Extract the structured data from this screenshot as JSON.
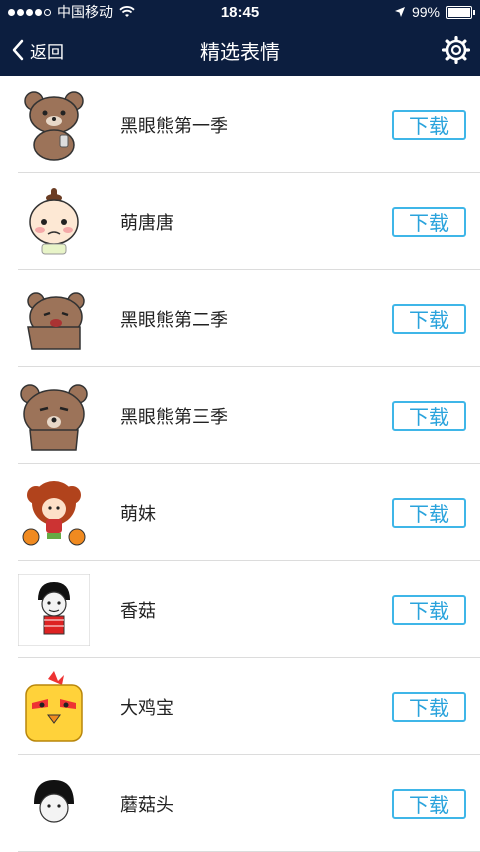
{
  "status": {
    "carrier": "中国移动",
    "time": "18:45",
    "battery": "99%"
  },
  "nav": {
    "back_label": "返回",
    "title": "精选表情"
  },
  "items": [
    {
      "name": "黑眼熊第一季",
      "download_label": "下载"
    },
    {
      "name": "萌唐唐",
      "download_label": "下载"
    },
    {
      "name": "黑眼熊第二季",
      "download_label": "下载"
    },
    {
      "name": "黑眼熊第三季",
      "download_label": "下载"
    },
    {
      "name": "萌妹",
      "download_label": "下载"
    },
    {
      "name": "香菇",
      "download_label": "下载"
    },
    {
      "name": "大鸡宝",
      "download_label": "下载"
    },
    {
      "name": "蘑菇头",
      "download_label": "下载"
    }
  ],
  "colors": {
    "nav_bg": "#0c1e3f",
    "accent": "#3fb6e8",
    "divider": "#dcdcdc"
  },
  "icons": {
    "back": "chevron-left-icon",
    "settings": "gear-icon",
    "location": "location-arrow-icon",
    "wifi": "wifi-icon",
    "battery": "battery-icon"
  }
}
